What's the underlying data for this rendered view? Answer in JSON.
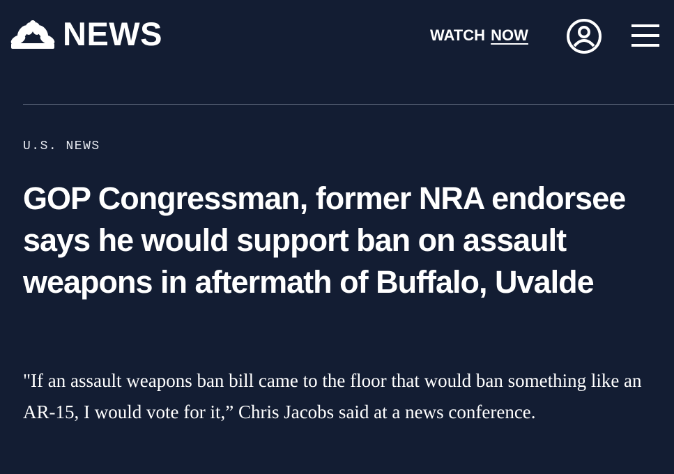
{
  "header": {
    "logo_text": "NEWS",
    "logo_icon": "nbc-peacock-icon",
    "watch_label": "WATCH",
    "now_label": "NOW",
    "account_icon": "user-account-icon",
    "menu_icon": "hamburger-menu-icon"
  },
  "article": {
    "category": "U.S. NEWS",
    "headline": "GOP Congressman, former NRA endorsee says he would support ban on assault weapons in aftermath of Buffalo, Uvalde",
    "dek": "\"If an assault weapons ban bill came to the floor that would ban something like an AR-15, I would vote for it,” Chris Jacobs said at a news conference."
  },
  "colors": {
    "background": "#131d33",
    "text": "#ffffff",
    "divider": "#6b7488"
  }
}
